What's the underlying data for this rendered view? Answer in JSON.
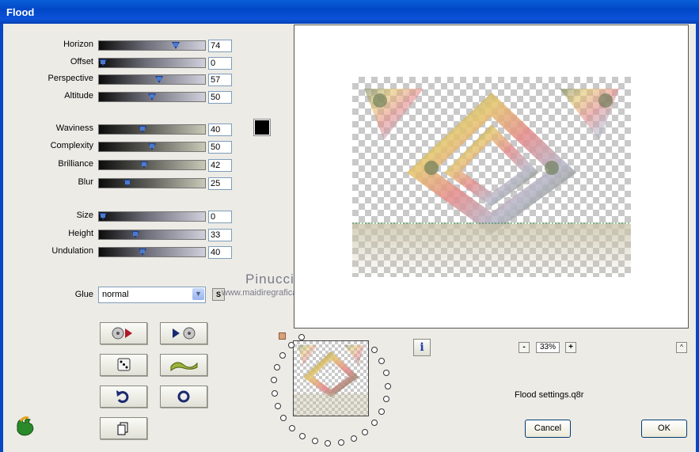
{
  "window": {
    "title": "Flood"
  },
  "sliders": [
    {
      "id": "horizon",
      "label": "Horizon",
      "value": "74",
      "level": 74,
      "style": "gray"
    },
    {
      "id": "offset",
      "label": "Offset",
      "value": "0",
      "level": 0,
      "style": "gray"
    },
    {
      "id": "perspective",
      "label": "Perspective",
      "value": "57",
      "level": 57,
      "style": "gray"
    },
    {
      "id": "altitude",
      "label": "Altitude",
      "value": "50",
      "level": 50,
      "style": "gray"
    },
    {
      "id": "waviness",
      "label": "Waviness",
      "value": "40",
      "level": 40,
      "style": "green"
    },
    {
      "id": "complexity",
      "label": "Complexity",
      "value": "50",
      "level": 50,
      "style": "green"
    },
    {
      "id": "brilliance",
      "label": "Brilliance",
      "value": "42",
      "level": 42,
      "style": "green"
    },
    {
      "id": "blur",
      "label": "Blur",
      "value": "25",
      "level": 25,
      "style": "green"
    },
    {
      "id": "size",
      "label": "Size",
      "value": "0",
      "level": 0,
      "style": "gray"
    },
    {
      "id": "height",
      "label": "Height",
      "value": "33",
      "level": 33,
      "style": "gray"
    },
    {
      "id": "undulation",
      "label": "Undulation",
      "value": "40",
      "level": 40,
      "style": "gray"
    }
  ],
  "color_swatch": "#000000",
  "glue": {
    "label": "Glue",
    "value": "normal",
    "s_button": "S"
  },
  "watermark": {
    "name": "Pinuccia",
    "url": "www.maidiregrafica.eu"
  },
  "buttons": {
    "zoom_minus": "-",
    "zoom_plus": "+",
    "zoom_level": "33%",
    "scroll_up": "^",
    "info": "i",
    "cancel": "Cancel",
    "ok": "OK"
  },
  "settings_file": "Flood settings.q8r",
  "icons": [
    "play-reverse-icon",
    "play-forward-icon",
    "dice-icon",
    "wave-icon",
    "undo-icon",
    "reset-circle-icon",
    "copy-icon",
    "logo-icon",
    "info-icon"
  ]
}
